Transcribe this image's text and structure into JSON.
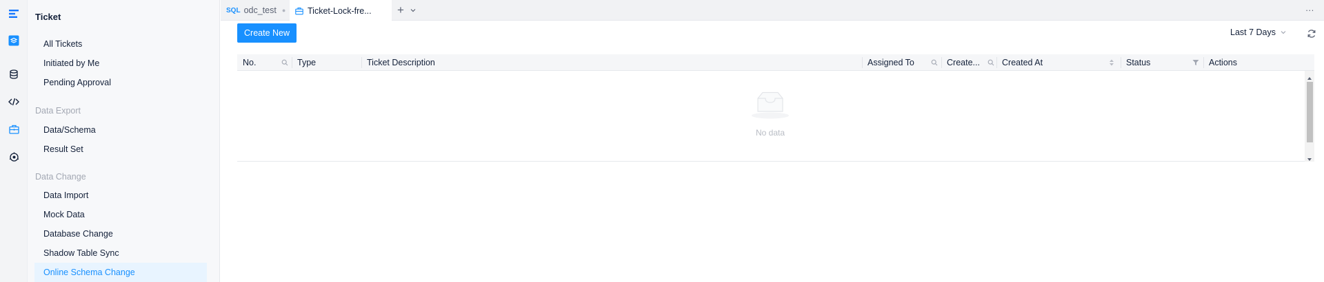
{
  "rail": {
    "icons": [
      "logo-icon",
      "workspace-icon",
      "database-icon",
      "code-icon",
      "ticket-icon",
      "security-icon"
    ]
  },
  "sidebar": {
    "title": "Ticket",
    "items_top": [
      "All Tickets",
      "Initiated by Me",
      "Pending Approval"
    ],
    "group_export": "Data Export",
    "items_export": [
      "Data/Schema",
      "Result Set"
    ],
    "group_change": "Data Change",
    "items_change": [
      "Data Import",
      "Mock Data",
      "Database Change",
      "Shadow Table Sync",
      "Online Schema Change"
    ],
    "active_item": "Online Schema Change"
  },
  "tabs": {
    "items": [
      {
        "badge": "SQL",
        "label": "odc_test",
        "active": false
      },
      {
        "label": "Ticket-Lock-fre...",
        "active": true
      }
    ],
    "add_label": "+",
    "more_label": "···"
  },
  "toolbar": {
    "create_label": "Create New",
    "range_label": "Last 7 Days"
  },
  "table": {
    "columns": [
      "No.",
      "Type",
      "Ticket Description",
      "Assigned To",
      "Create...",
      "Created At",
      "Status",
      "Actions"
    ],
    "empty_text": "No data"
  },
  "colors": {
    "accent": "#1890ff",
    "active_bg": "#e8f4ff"
  }
}
